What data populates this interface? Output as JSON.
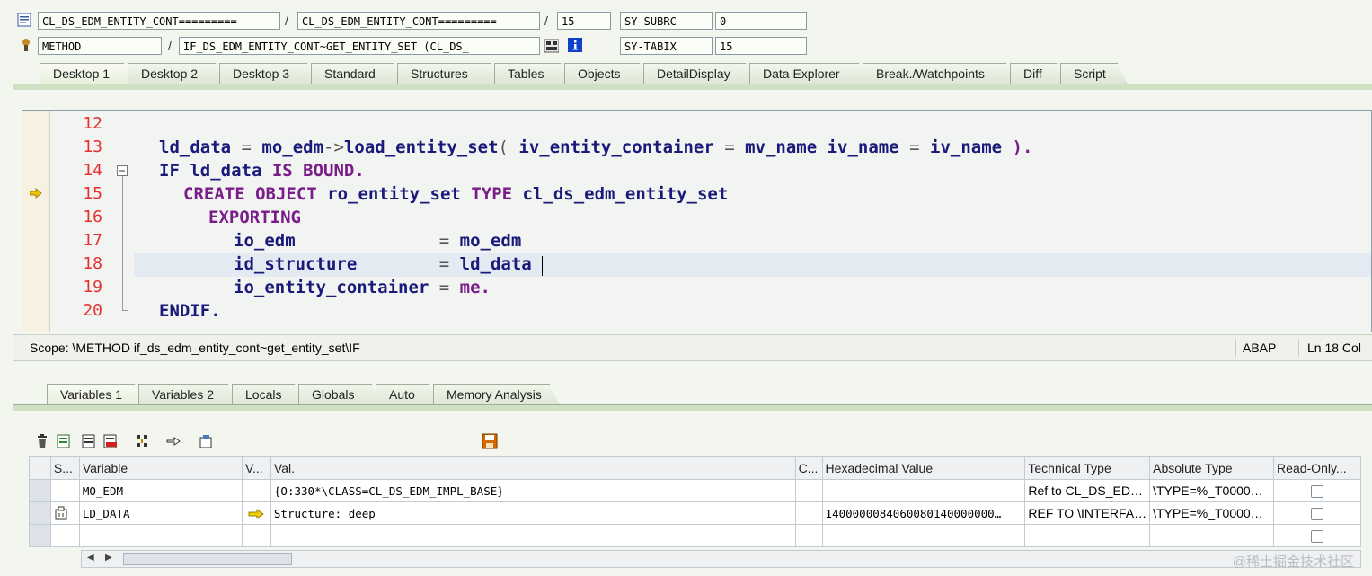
{
  "header": {
    "row1": {
      "program": "CL_DS_EDM_ENTITY_CONT=========",
      "include": "CL_DS_EDM_ENTITY_CONT=========",
      "line": "15",
      "sysfield_name": "SY-SUBRC",
      "sysfield_value": "0"
    },
    "row2": {
      "event_type": "METHOD",
      "event": "IF_DS_EDM_ENTITY_CONT~GET_ENTITY_SET (CL_DS_",
      "sysfield_name": "SY-TABIX",
      "sysfield_value": "15"
    },
    "separator": "/"
  },
  "main_tabs": [
    {
      "label": "Desktop 1",
      "active": true
    },
    {
      "label": "Desktop 2"
    },
    {
      "label": "Desktop 3"
    },
    {
      "label": "Standard"
    },
    {
      "label": "Structures"
    },
    {
      "label": "Tables"
    },
    {
      "label": "Objects"
    },
    {
      "label": "DetailDisplay"
    },
    {
      "label": "Data Explorer"
    },
    {
      "label": "Break./Watchpoints"
    },
    {
      "label": "Diff"
    },
    {
      "label": "Script"
    }
  ],
  "editor": {
    "lines": [
      {
        "num": "12"
      },
      {
        "num": "13"
      },
      {
        "num": "14"
      },
      {
        "num": "15"
      },
      {
        "num": "16"
      },
      {
        "num": "17"
      },
      {
        "num": "18"
      },
      {
        "num": "19"
      },
      {
        "num": "20"
      }
    ],
    "code": {
      "l13a": "ld_data ",
      "l13b": "= ",
      "l13c": "mo_edm",
      "l13d": "->",
      "l13e": "load_entity_set",
      "l13f": "( ",
      "l13g": "iv_entity_container ",
      "l13h": "= ",
      "l13i": "mv_name iv_name ",
      "l13j": "= ",
      "l13k": "iv_name ",
      "l13l": ").",
      "l14a": "IF ",
      "l14b": "ld_data ",
      "l14c": "IS BOUND.",
      "l15a": "CREATE OBJECT ",
      "l15b": "ro_entity_set ",
      "l15c": "TYPE ",
      "l15d": "cl_ds_edm_entity_set",
      "l16": "EXPORTING",
      "l17a": "io_edm              ",
      "l17b": "= ",
      "l17c": "mo_edm",
      "l18a": "id_structure        ",
      "l18b": "= ",
      "l18c": "ld_data",
      "l19a": "io_entity_container ",
      "l19b": "= ",
      "l19c": "me.",
      "l20": "ENDIF."
    }
  },
  "status": {
    "scope": "Scope: \\METHOD if_ds_edm_entity_cont~get_entity_set\\IF",
    "lang": "ABAP",
    "position": "Ln  18 Col"
  },
  "var_tabs": [
    {
      "label": "Variables 1",
      "active": true
    },
    {
      "label": "Variables 2"
    },
    {
      "label": "Locals"
    },
    {
      "label": "Globals"
    },
    {
      "label": "Auto"
    },
    {
      "label": "Memory Analysis"
    }
  ],
  "grid": {
    "columns": [
      "S...",
      "Variable",
      "V...",
      "Val.",
      "C...",
      "Hexadecimal Value",
      "Technical Type",
      "Absolute Type",
      "Read-Only..."
    ],
    "rows": [
      {
        "variable": "MO_EDM",
        "value": "{O:330*\\CLASS=CL_DS_EDM_IMPL_BASE}",
        "hex": "",
        "tech": "Ref to CL_DS_ED…",
        "abs": "\\TYPE=%_T0000…"
      },
      {
        "variable": "LD_DATA",
        "value": "Structure: deep",
        "hex": "1400000084060080140000000…",
        "tech": "REF TO \\INTERFA…",
        "abs": "\\TYPE=%_T0000…"
      }
    ]
  },
  "watermark": "@稀土掘金技术社区",
  "colors": {
    "keyword": "#7a1c8a",
    "identifier": "#1a1a7a",
    "line_number": "#e53030",
    "tab_bg": "#dfe6d6"
  }
}
